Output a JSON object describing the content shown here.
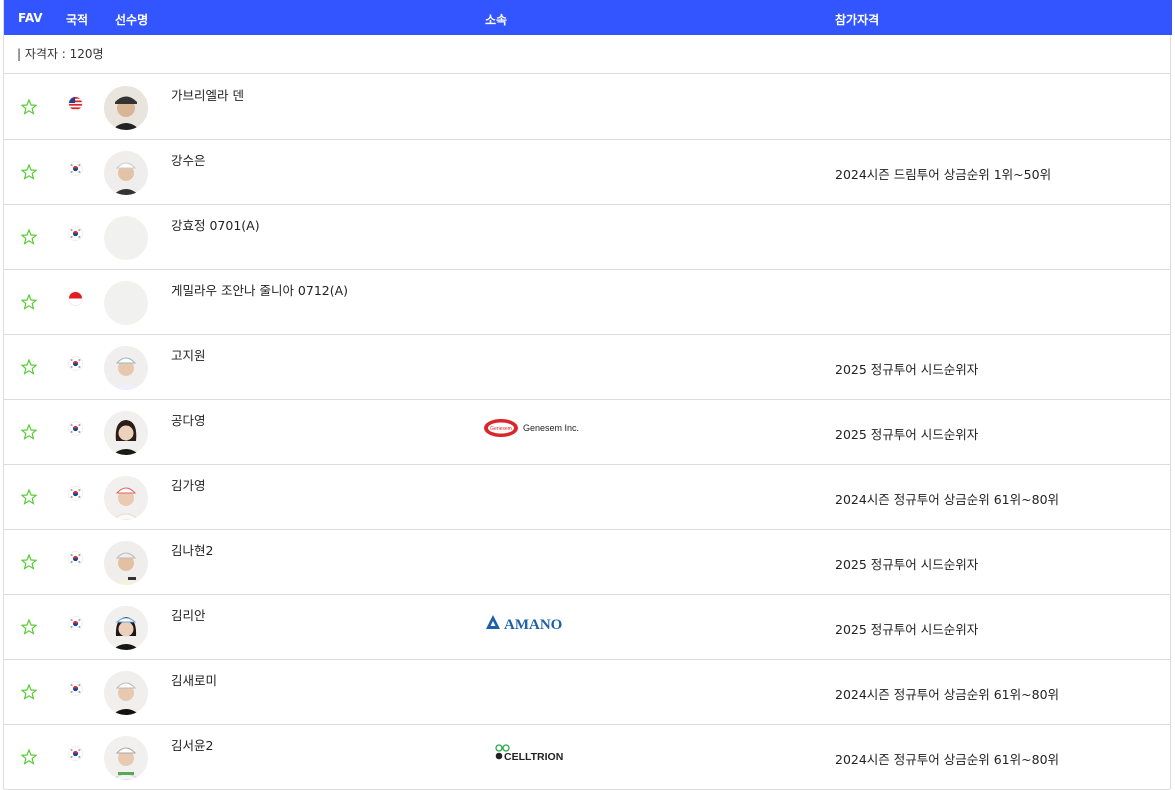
{
  "header": {
    "fav": "FAV",
    "nation": "국적",
    "player": "선수명",
    "affiliation": "소속",
    "qualification": "참가자격"
  },
  "summary": {
    "count_label": "| 자격자 : 120명"
  },
  "colors": {
    "header_bg": "#3355ff",
    "star": "#55cc33",
    "korea_red": "#cd2e3a",
    "korea_blue": "#0047a0"
  },
  "players": [
    {
      "name": "가브리엘라 덴",
      "flag": "usa",
      "sponsor": "",
      "qualification": ""
    },
    {
      "name": "강수은",
      "flag": "korea",
      "sponsor": "",
      "qualification": "2024시즌 드림투어 상금순위 1위~50위"
    },
    {
      "name": "강효정 0701(A)",
      "flag": "korea",
      "sponsor": "",
      "qualification": ""
    },
    {
      "name": "게밀라우 조안나 줄니아 0712(A)",
      "flag": "indonesia",
      "sponsor": "",
      "qualification": ""
    },
    {
      "name": "고지원",
      "flag": "korea",
      "sponsor": "",
      "qualification": "2025 정규투어 시드순위자"
    },
    {
      "name": "공다영",
      "flag": "korea",
      "sponsor": "Genesem Inc.",
      "sponsor_badge": "Genesem",
      "qualification": "2025 정규투어 시드순위자"
    },
    {
      "name": "김가영",
      "flag": "korea",
      "sponsor": "",
      "qualification": "2024시즌 정규투어 상금순위 61위~80위"
    },
    {
      "name": "김나현2",
      "flag": "korea",
      "sponsor": "",
      "qualification": "2025 정규투어 시드순위자"
    },
    {
      "name": "김리안",
      "flag": "korea",
      "sponsor": "AMANO",
      "qualification": "2025 정규투어 시드순위자"
    },
    {
      "name": "김새로미",
      "flag": "korea",
      "sponsor": "",
      "qualification": "2024시즌 정규투어 상금순위 61위~80위"
    },
    {
      "name": "김서윤2",
      "flag": "korea",
      "sponsor": "CELLTRION",
      "qualification": "2024시즌 정규투어 상금순위 61위~80위"
    }
  ]
}
